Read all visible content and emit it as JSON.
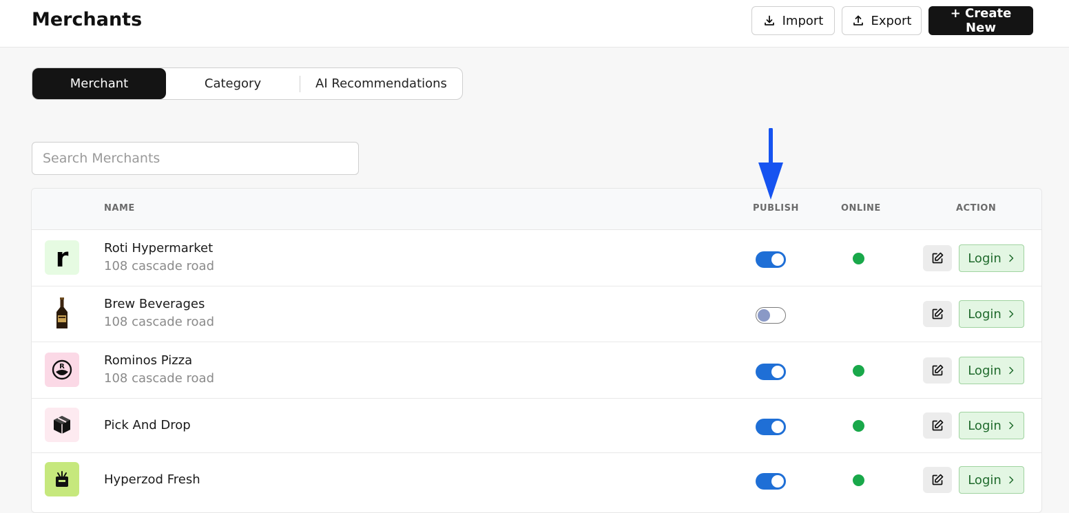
{
  "header": {
    "title": "Merchants",
    "import_label": "Import",
    "export_label": "Export",
    "create_label": "+ Create New"
  },
  "tabs": [
    {
      "label": "Merchant",
      "active": true
    },
    {
      "label": "Category",
      "active": false
    },
    {
      "label": "AI Recommendations",
      "active": false
    }
  ],
  "search": {
    "placeholder": "Search Merchants",
    "value": ""
  },
  "table": {
    "columns": {
      "name": "NAME",
      "publish": "PUBLISH",
      "online": "ONLINE",
      "action": "ACTION"
    },
    "rows": [
      {
        "name": "Roti Hypermarket",
        "address": "108 cascade road",
        "publish": true,
        "online": true,
        "logo_icon": "roti-r-logo-icon",
        "logo_bg": "#e6fbe2",
        "login_label": "Login"
      },
      {
        "name": "Brew Beverages",
        "address": "108 cascade road",
        "publish": false,
        "online": false,
        "logo_icon": "beer-bottle-icon",
        "logo_bg": "#ffffff",
        "login_label": "Login"
      },
      {
        "name": "Rominos Pizza",
        "address": "108 cascade road",
        "publish": true,
        "online": true,
        "logo_icon": "rominos-pizza-logo-icon",
        "logo_bg": "#fbd9e6",
        "login_label": "Login"
      },
      {
        "name": "Pick And Drop",
        "address": "",
        "publish": true,
        "online": true,
        "logo_icon": "package-box-icon",
        "logo_bg": "#fdeaf0",
        "login_label": "Login"
      },
      {
        "name": "Hyperzod Fresh",
        "address": "",
        "publish": true,
        "online": true,
        "logo_icon": "grocery-basket-icon",
        "logo_bg": "#c6e87d",
        "login_label": "Login"
      }
    ]
  },
  "colors": {
    "toggle_on": "#1f6fd6",
    "online_dot": "#19a84a",
    "login_bg": "#e3f6e3",
    "annotation_arrow": "#1653f0"
  }
}
